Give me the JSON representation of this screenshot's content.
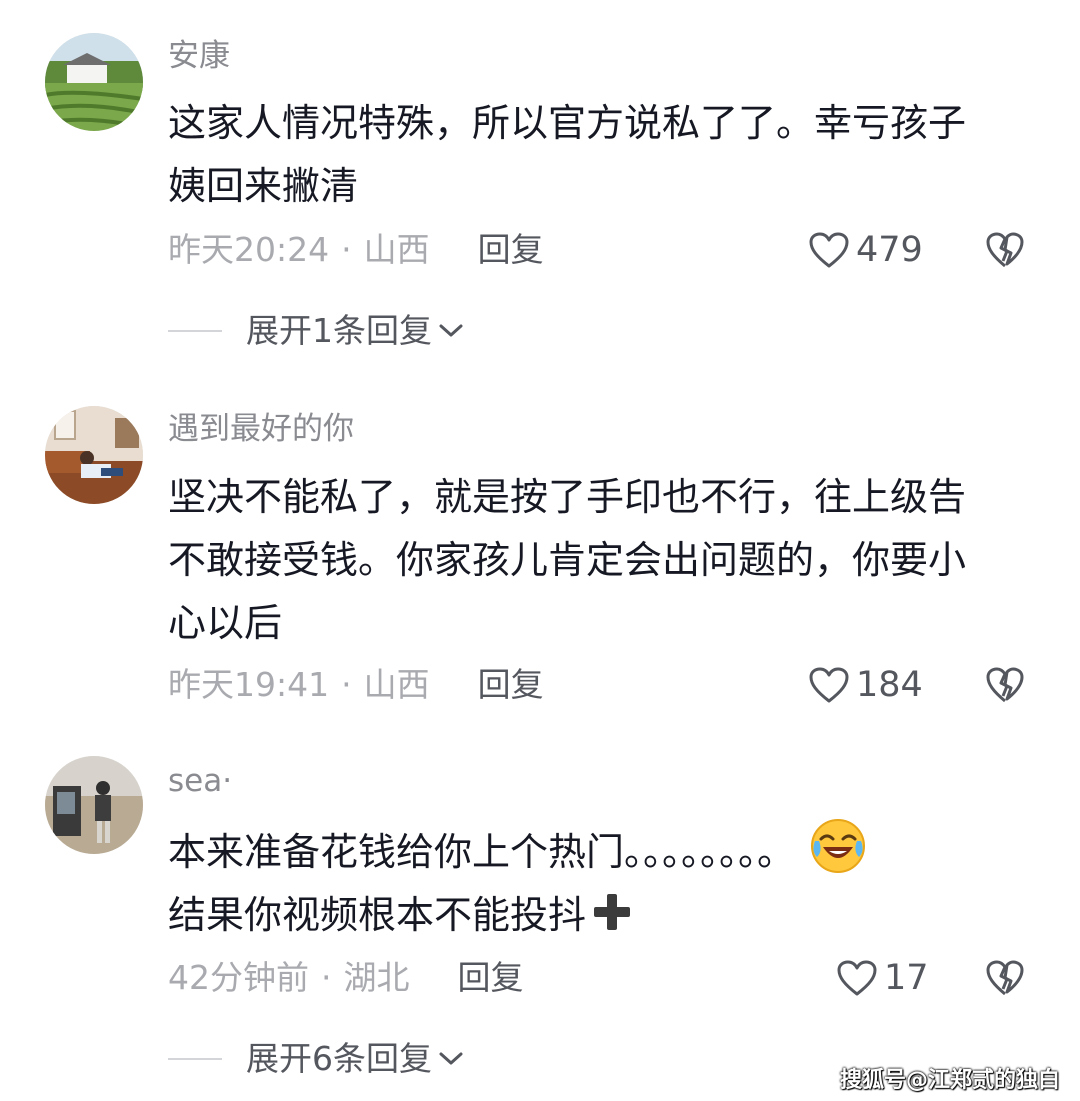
{
  "comments": [
    {
      "username": "安康",
      "lines": [
        "这家人情况特殊，所以官方说私了了。幸亏孩子",
        "姨回来撇清"
      ],
      "time": "昨天20:24",
      "separator": "·",
      "location": "山西",
      "reply_label": "回复",
      "likes": "479",
      "expand_label": "展开1条回复",
      "avatar_icon": "farm-landscape-avatar"
    },
    {
      "username": "遇到最好的你",
      "lines": [
        "坚决不能私了，就是按了手印也不行，往上级告",
        "不敢接受钱。你家孩儿肯定会出问题的，你要小",
        "心以后"
      ],
      "time": "昨天19:41",
      "separator": "·",
      "location": "山西",
      "reply_label": "回复",
      "likes": "184",
      "avatar_icon": "person-on-sofa-avatar"
    },
    {
      "username": "sea·",
      "lines": [
        "本来准备花钱给你上个热门。。。。。。。。",
        "结果你视频根本不能投抖"
      ],
      "emoji_icon": "laughing-crying-emoji",
      "plus_icon": "plus-emoji",
      "time": "42分钟前",
      "separator": "·",
      "location": "湖北",
      "reply_label": "回复",
      "likes": "17",
      "expand_label": "展开6条回复",
      "avatar_icon": "person-by-car-avatar"
    }
  ],
  "watermark": "搜狐号@江郑贰的独白",
  "colors": {
    "username": "#8a8b91",
    "content": "#161823",
    "meta": "#a9aaaf",
    "action": "#55575f",
    "divider": "#d4d5d8"
  }
}
